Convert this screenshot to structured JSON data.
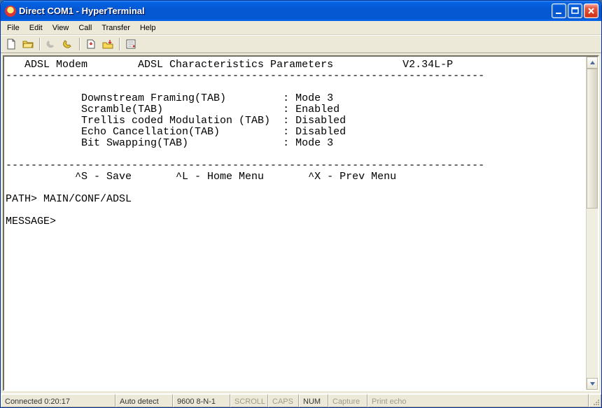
{
  "title": "Direct COM1 - HyperTerminal",
  "menu": {
    "file": "File",
    "edit": "Edit",
    "view": "View",
    "call": "Call",
    "transfer": "Transfer",
    "help": "Help"
  },
  "toolbar_icons": {
    "new": "new-file-icon",
    "open": "open-folder-icon",
    "connect": "phone-connect-icon",
    "disconnect": "phone-disconnect-icon",
    "send": "send-file-icon",
    "receive": "receive-file-icon",
    "properties": "properties-icon"
  },
  "terminal": {
    "header_left": "   ADSL Modem",
    "header_center": "        ADSL Characteristics Parameters",
    "header_right": "           V2.34L-P",
    "divider": "----------------------------------------------------------------------------",
    "params": [
      {
        "label": "Downstream Framing(TAB)",
        "value": "Mode 3"
      },
      {
        "label": "Scramble(TAB)",
        "value": "Enabled"
      },
      {
        "label": "Trellis coded Modulation (TAB)",
        "value": "Disabled"
      },
      {
        "label": "Echo Cancellation(TAB)",
        "value": "Disabled"
      },
      {
        "label": "Bit Swapping(TAB)",
        "value": "Mode 3"
      }
    ],
    "shortcuts": "           ^S - Save       ^L - Home Menu       ^X - Prev Menu",
    "path": "PATH> MAIN/CONF/ADSL",
    "message": "MESSAGE>"
  },
  "status": {
    "connected": "Connected 0:20:17",
    "detect": "Auto detect",
    "serial": "9600 8-N-1",
    "scroll": "SCROLL",
    "caps": "CAPS",
    "num": "NUM",
    "capture": "Capture",
    "printecho": "Print echo"
  }
}
